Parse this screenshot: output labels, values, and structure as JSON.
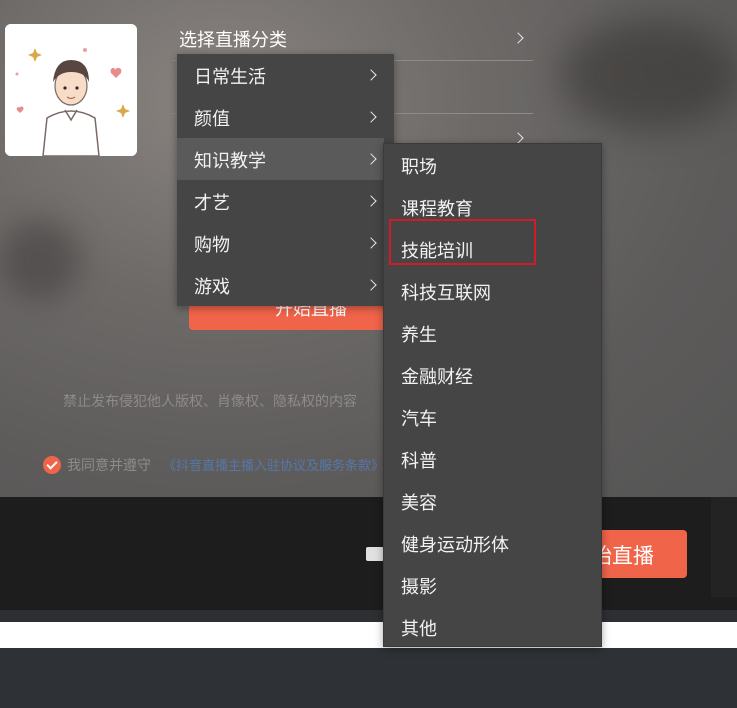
{
  "form": {
    "category_label": "选择直播分类",
    "start_button_label": "开始直播",
    "notice": "禁止发布侵犯他人版权、肖像权、隐私权的内容",
    "agree_text": "我同意并遵守",
    "agree_link": "《抖音直播主播入驻协议及服务条款》"
  },
  "bottom": {
    "go_live_label": "始直播"
  },
  "menu": {
    "categories": [
      {
        "label": "日常生活"
      },
      {
        "label": "颜值"
      },
      {
        "label": "知识教学"
      },
      {
        "label": "才艺"
      },
      {
        "label": "购物"
      },
      {
        "label": "游戏"
      }
    ],
    "active_category": "知识教学",
    "subcategories": [
      {
        "label": "职场"
      },
      {
        "label": "课程教育"
      },
      {
        "label": "技能培训"
      },
      {
        "label": "科技互联网"
      },
      {
        "label": "养生"
      },
      {
        "label": "金融财经"
      },
      {
        "label": "汽车"
      },
      {
        "label": "科普"
      },
      {
        "label": "美容"
      },
      {
        "label": "健身运动形体"
      },
      {
        "label": "摄影"
      },
      {
        "label": "其他"
      }
    ],
    "highlighted_subcategory": "技能培训"
  },
  "colors": {
    "accent": "#f0644a",
    "menu_bg": "#454545",
    "highlight": "#d21a2a"
  }
}
